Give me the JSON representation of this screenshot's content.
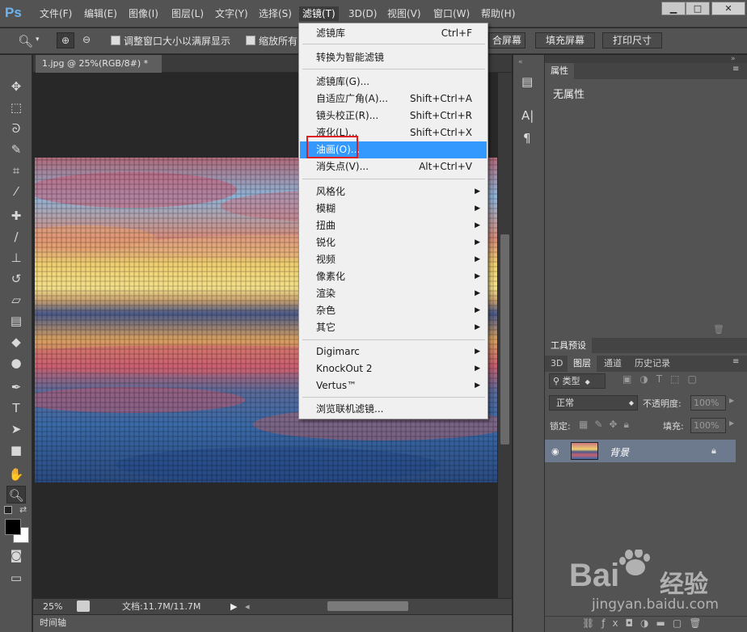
{
  "app": {
    "logo": "Ps"
  },
  "menubar": {
    "items": [
      "文件(F)",
      "编辑(E)",
      "图像(I)",
      "图层(L)",
      "文字(Y)",
      "选择(S)",
      "滤镜(T)",
      "3D(D)",
      "视图(V)",
      "窗口(W)",
      "帮助(H)"
    ],
    "window_controls": [
      "▁",
      "□",
      "✕"
    ]
  },
  "options": {
    "resize_windows": "调整窗口大小以满屏显示",
    "zoom_all": "缩放所有",
    "fill_screen_partial": "合屏幕",
    "fill_screen": "填充屏幕",
    "print_size": "打印尺寸"
  },
  "document": {
    "tab_title": "1.jpg @ 25%(RGB/8#) *",
    "close": "×",
    "zoom": "25%",
    "file_info": "文档:11.7M/11.7M"
  },
  "timeline": {
    "label": "时间轴"
  },
  "filter_menu": {
    "items": [
      {
        "label": "滤镜库",
        "shortcut": "Ctrl+F"
      },
      {
        "label": "转换为智能滤镜",
        "shortcut": ""
      },
      {
        "label": "滤镜库(G)...",
        "shortcut": ""
      },
      {
        "label": "自适应广角(A)...",
        "shortcut": "Shift+Ctrl+A"
      },
      {
        "label": "镜头校正(R)...",
        "shortcut": "Shift+Ctrl+R"
      },
      {
        "label": "液化(L)...",
        "shortcut": "Shift+Ctrl+X"
      },
      {
        "label": "油画(O)...",
        "shortcut": ""
      },
      {
        "label": "消失点(V)...",
        "shortcut": "Alt+Ctrl+V"
      },
      {
        "label": "风格化",
        "shortcut": ""
      },
      {
        "label": "模糊",
        "shortcut": ""
      },
      {
        "label": "扭曲",
        "shortcut": ""
      },
      {
        "label": "锐化",
        "shortcut": ""
      },
      {
        "label": "视频",
        "shortcut": ""
      },
      {
        "label": "像素化",
        "shortcut": ""
      },
      {
        "label": "渲染",
        "shortcut": ""
      },
      {
        "label": "杂色",
        "shortcut": ""
      },
      {
        "label": "其它",
        "shortcut": ""
      },
      {
        "label": "Digimarc",
        "shortcut": ""
      },
      {
        "label": "KnockOut 2",
        "shortcut": ""
      },
      {
        "label": "Vertus™",
        "shortcut": ""
      },
      {
        "label": "浏览联机滤镜...",
        "shortcut": ""
      }
    ],
    "highlighted": "油画(O)..."
  },
  "properties_panel": {
    "tab": "属性",
    "empty_text": "无属性"
  },
  "tool_presets_panel": {
    "tab": "工具预设"
  },
  "layers_panel": {
    "tabs": [
      "3D",
      "图层",
      "通道",
      "历史记录"
    ],
    "filter_kind": "类型",
    "blend_mode": "正常",
    "opacity_label": "不透明度:",
    "opacity_value": "100%",
    "lock_label": "锁定:",
    "fill_label": "填充:",
    "fill_value": "100%",
    "layer_name": "背景"
  },
  "watermark": {
    "brand": "Bai",
    "brand_cn": "经验",
    "url": "jingyan.baidu.com"
  },
  "colors": {
    "highlight": "#3399ff",
    "callout": "#e02020",
    "ps_blue": "#6cb4f0"
  }
}
